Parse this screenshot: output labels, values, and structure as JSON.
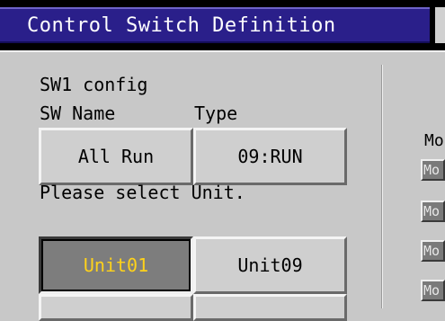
{
  "window": {
    "title": "Control Switch Definition"
  },
  "config": {
    "heading": "SW1 config",
    "sw_name_label": "SW Name",
    "type_label": "Type",
    "sw_name_value": "All Run",
    "type_value": "09:RUN"
  },
  "unit_select": {
    "prompt": "Please select Unit.",
    "units": [
      {
        "label": "Unit01",
        "selected": true
      },
      {
        "label": "Unit09",
        "selected": false
      }
    ]
  },
  "right_panel": {
    "heading": "Mo",
    "buttons": [
      "Mo",
      "Mo",
      "Mo",
      "Mo"
    ]
  },
  "colors": {
    "title_bar": "#2a1f8a",
    "panel_bg": "#c8c8c8",
    "selected_text": "#ffd21a"
  }
}
